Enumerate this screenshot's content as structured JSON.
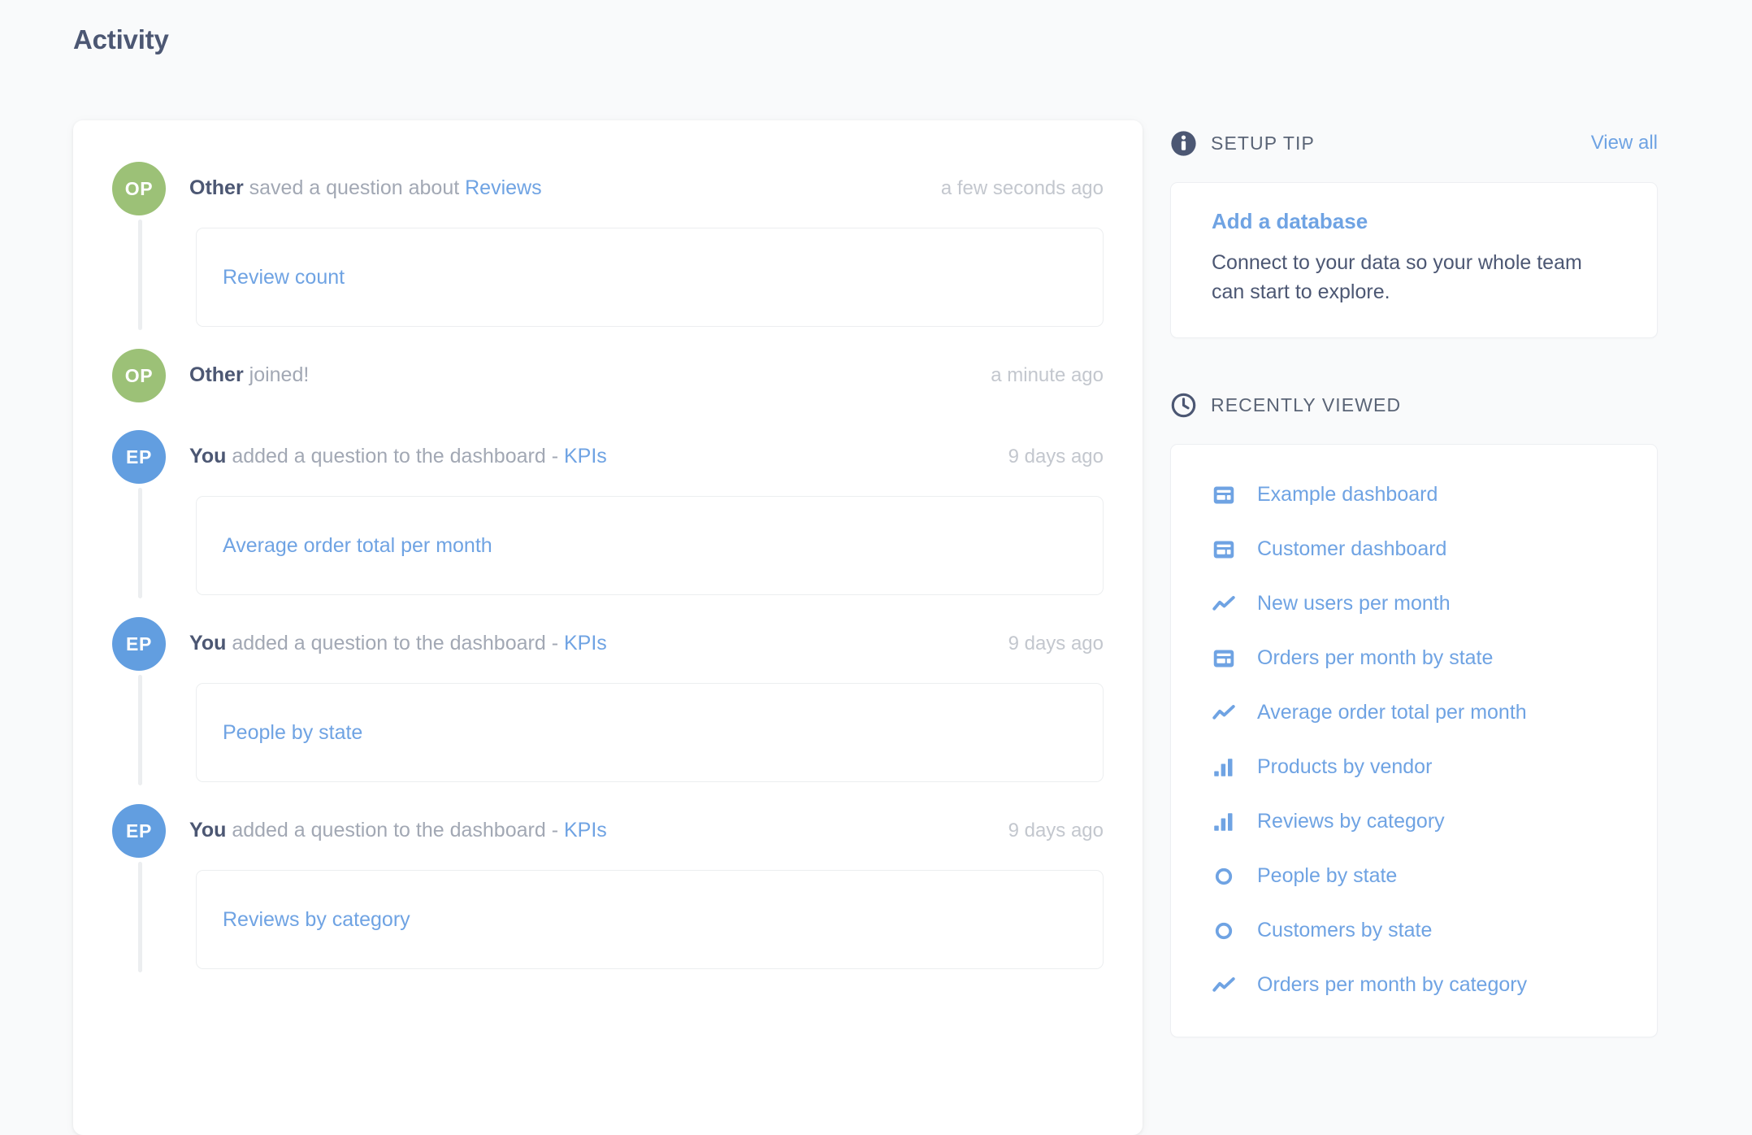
{
  "page": {
    "title": "Activity"
  },
  "activity": {
    "items": [
      {
        "avatar_initials": "OP",
        "avatar_color": "#9cc177",
        "actor": "Other",
        "verb": " saved a question about ",
        "target": "Reviews",
        "timestamp": "a few seconds ago",
        "question": "Review count"
      },
      {
        "avatar_initials": "OP",
        "avatar_color": "#9cc177",
        "actor": "Other",
        "verb": " joined!",
        "target": "",
        "timestamp": "a minute ago",
        "question": ""
      },
      {
        "avatar_initials": "EP",
        "avatar_color": "#629ee0",
        "actor": "You",
        "verb": " added a question to the dashboard - ",
        "target": "KPIs",
        "timestamp": "9 days ago",
        "question": "Average order total per month"
      },
      {
        "avatar_initials": "EP",
        "avatar_color": "#629ee0",
        "actor": "You",
        "verb": " added a question to the dashboard - ",
        "target": "KPIs",
        "timestamp": "9 days ago",
        "question": "People by state"
      },
      {
        "avatar_initials": "EP",
        "avatar_color": "#629ee0",
        "actor": "You",
        "verb": " added a question to the dashboard - ",
        "target": "KPIs",
        "timestamp": "9 days ago",
        "question": "Reviews by category"
      }
    ]
  },
  "sidebar": {
    "setup_tip": {
      "icon": "info-icon",
      "heading": "SETUP TIP",
      "view_all_label": "View all",
      "tip_title": "Add a database",
      "tip_body": "Connect to your data so your whole team can start to explore."
    },
    "recently_viewed": {
      "icon": "clock-icon",
      "heading": "RECENTLY VIEWED",
      "items": [
        {
          "label": "Example dashboard",
          "icon": "dashboard-icon"
        },
        {
          "label": "Customer dashboard",
          "icon": "dashboard-icon"
        },
        {
          "label": "New users per month",
          "icon": "line-chart-icon"
        },
        {
          "label": "Orders per month by state",
          "icon": "dashboard-icon"
        },
        {
          "label": "Average order total per month",
          "icon": "line-chart-icon"
        },
        {
          "label": "Products by vendor",
          "icon": "bar-chart-icon"
        },
        {
          "label": "Reviews by category",
          "icon": "bar-chart-icon"
        },
        {
          "label": "People by state",
          "icon": "pin-icon"
        },
        {
          "label": "Customers by state",
          "icon": "pin-icon"
        },
        {
          "label": "Orders per month by category",
          "icon": "line-chart-icon"
        }
      ]
    }
  },
  "colors": {
    "accent_blue": "#6fa3e3",
    "avatar_green": "#9cc177",
    "avatar_blue": "#629ee0",
    "text_dark": "#4c5773",
    "text_muted": "#a2a8b4",
    "page_bg": "#f9fafb"
  }
}
